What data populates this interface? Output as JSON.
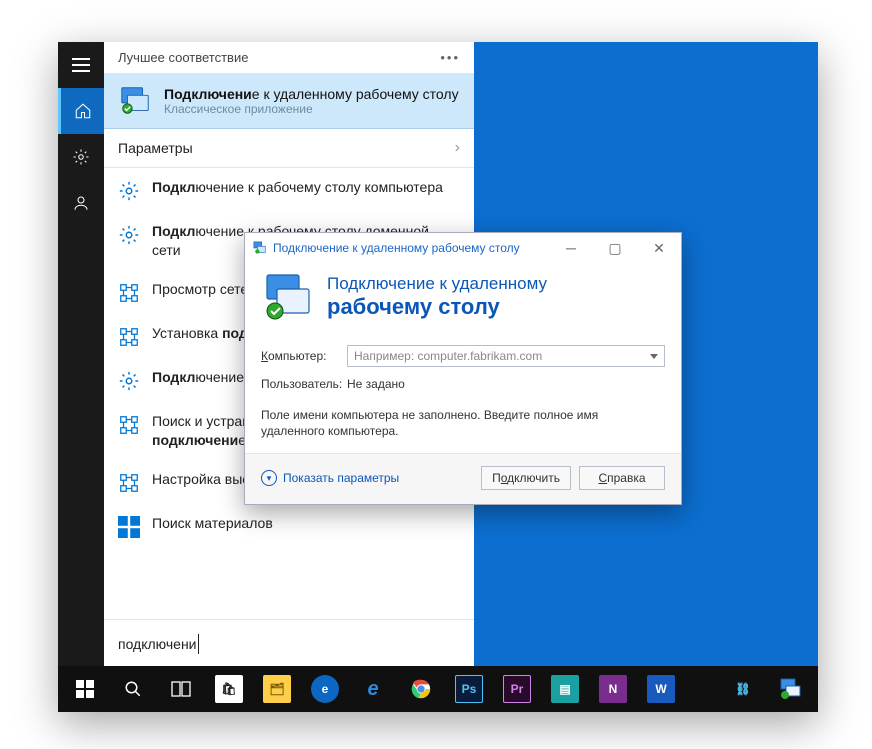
{
  "start": {
    "header": "Лучшее соответствие",
    "best": {
      "title_html": "<b>Подключени</b>е к удаленному рабочему столу",
      "subtitle": "Классическое приложение"
    },
    "section": "Параметры",
    "items": [
      "<b>Подкл</b>ючение к рабочему столу компьютера",
      "<b>Подкл</b>ючение к рабочему столу доменной сети",
      "Просмотр сетевых <b>подключен</b>ий",
      "Установка <b>подключени</b>я или сети",
      "<b>Подкл</b>ючение к рабочему столу столам",
      "Поиск и устранение проблем с сетью и <b>подключени</b>ем",
      "Настройка высокоскоростного <b>подключени</b>я",
      "Поиск материалов"
    ],
    "search": "подключени"
  },
  "rdp": {
    "title": "Подключение к удаленному рабочему столу",
    "hero_line1_html": "<span class='und'>П</span>одключение к удаленному",
    "hero_line2": "рабочему столу",
    "lbl_computer_html": "<span class='und'>К</span>омпьютер:",
    "lbl_user": "Пользователь:",
    "combo_placeholder": "Например: computer.fabrikam.com",
    "user_value": "Не задано",
    "msg": "Поле имени компьютера не заполнено. Введите полное имя удаленного компьютера.",
    "link_html": "<span class='und'>П</span>оказать параметры",
    "btn_connect_html": "П<span class='und'>о</span>дключить",
    "btn_help_html": "<span class='und'>С</span>правка"
  }
}
